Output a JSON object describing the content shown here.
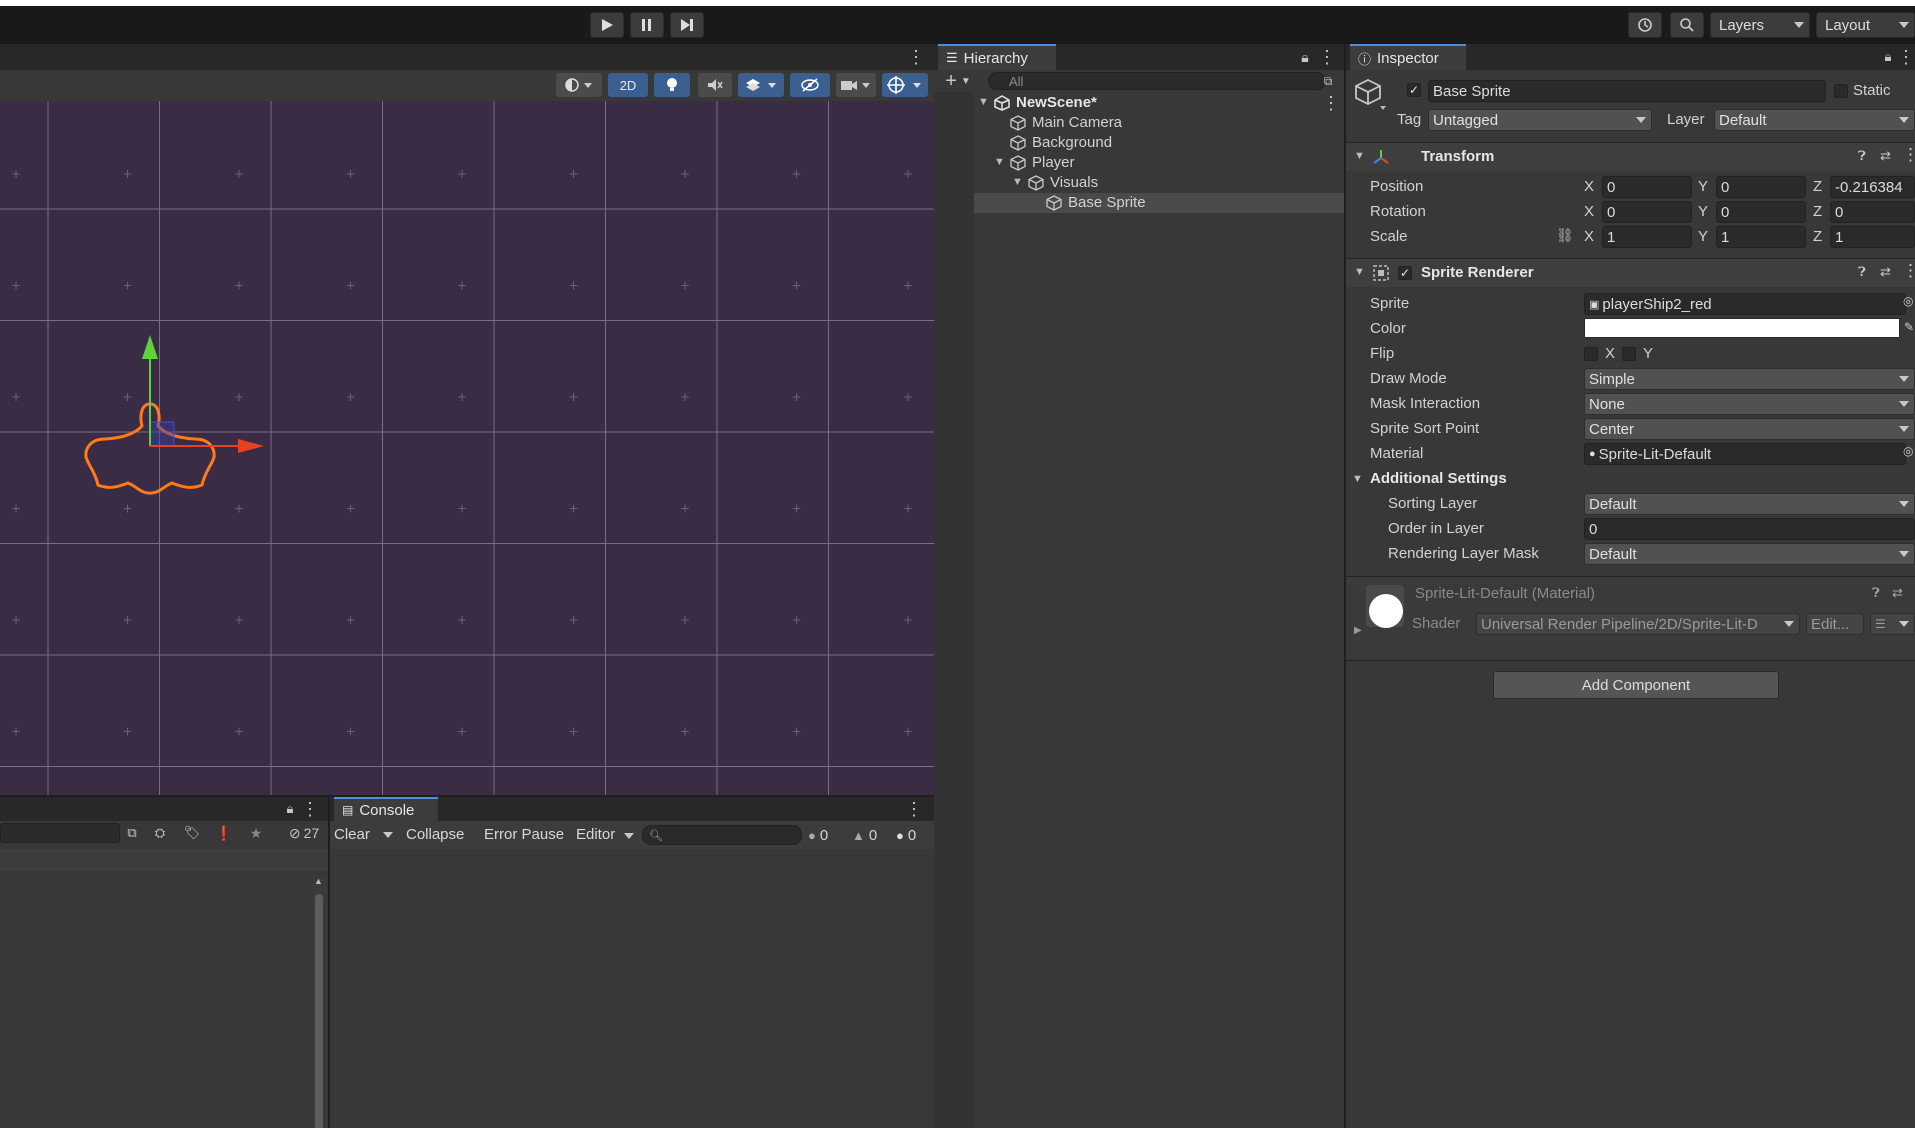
{
  "toolbar": {
    "play_icon": "play-icon",
    "pause_icon": "pause-icon",
    "step_icon": "step-icon",
    "layers_label": "Layers",
    "layout_label": "Layout"
  },
  "scene": {
    "mode_2d": "2D"
  },
  "hierarchy": {
    "tab_label": "Hierarchy",
    "search_placeholder": "All",
    "scene_name": "NewScene*",
    "items": [
      {
        "label": "Main Camera"
      },
      {
        "label": "Background"
      },
      {
        "label": "Player"
      },
      {
        "label": "Visuals"
      },
      {
        "label": "Base Sprite"
      }
    ]
  },
  "inspector": {
    "tab_label": "Inspector",
    "object_name": "Base Sprite",
    "static_label": "Static",
    "tag_label": "Tag",
    "tag_value": "Untagged",
    "layer_label": "Layer",
    "layer_value": "Default",
    "transform": {
      "title": "Transform",
      "position_label": "Position",
      "rotation_label": "Rotation",
      "scale_label": "Scale",
      "x": "X",
      "y": "Y",
      "z": "Z",
      "position": [
        "0",
        "0",
        "-0.216384"
      ],
      "rotation": [
        "0",
        "0",
        "0"
      ],
      "scale": [
        "1",
        "1",
        "1"
      ]
    },
    "sprite_renderer": {
      "title": "Sprite Renderer",
      "sprite_label": "Sprite",
      "sprite_value": "playerShip2_red",
      "color_label": "Color",
      "flip_label": "Flip",
      "flip_x": "X",
      "flip_y": "Y",
      "draw_mode_label": "Draw Mode",
      "draw_mode_value": "Simple",
      "mask_label": "Mask Interaction",
      "mask_value": "None",
      "sort_point_label": "Sprite Sort Point",
      "sort_point_value": "Center",
      "material_label": "Material",
      "material_value": "Sprite-Lit-Default",
      "additional_label": "Additional Settings",
      "sorting_layer_label": "Sorting Layer",
      "sorting_layer_value": "Default",
      "order_label": "Order in Layer",
      "order_value": "0",
      "rendering_mask_label": "Rendering Layer Mask",
      "rendering_mask_value": "Default"
    },
    "material": {
      "title": "Sprite-Lit-Default (Material)",
      "shader_label": "Shader",
      "shader_value": "Universal Render Pipeline/2D/Sprite-Lit-D",
      "edit_label": "Edit..."
    },
    "add_component_label": "Add Component"
  },
  "project": {
    "hidden_count": "27"
  },
  "console": {
    "tab_label": "Console",
    "clear_label": "Clear",
    "collapse_label": "Collapse",
    "error_pause_label": "Error Pause",
    "editor_label": "Editor",
    "log_count": "0",
    "warn_count": "0",
    "error_count": "0"
  },
  "colors": {
    "scene_bg": "#3a2c45",
    "selection_outline": "#ff7a1a",
    "gizmo_y": "#5fd13a",
    "gizmo_x": "#e8421f",
    "accent": "#4a90e2"
  }
}
